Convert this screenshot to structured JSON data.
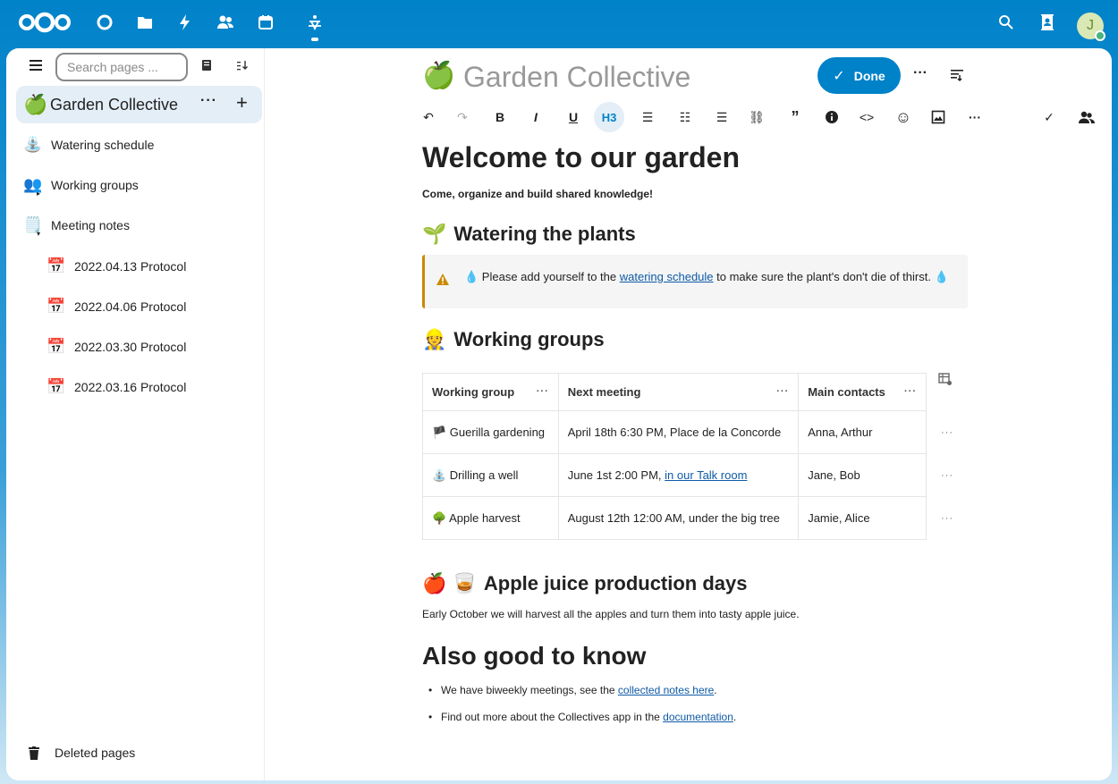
{
  "topbar": {
    "apps": [
      "dashboard-icon",
      "files-icon",
      "activity-icon",
      "contacts-icon",
      "calendar-icon",
      "collectives-icon"
    ],
    "search_icon": "search-icon",
    "contacts_menu_icon": "contacts-menu-icon",
    "avatar_initial": "J"
  },
  "sidebar": {
    "search_placeholder": "Search pages ...",
    "collective": {
      "emoji": "🍏",
      "title": "Garden Collective"
    },
    "pages": [
      {
        "emoji": "⛲",
        "label": "Watering schedule"
      },
      {
        "emoji": "👥",
        "label": "Working groups"
      },
      {
        "emoji": "🗒️",
        "label": "Meeting notes"
      },
      {
        "emoji": "📅",
        "label": "2022.04.13 Protocol"
      },
      {
        "emoji": "📅",
        "label": "2022.04.06 Protocol"
      },
      {
        "emoji": "📅",
        "label": "2022.03.30 Protocol"
      },
      {
        "emoji": "📅",
        "label": "2022.03.16 Protocol"
      }
    ],
    "deleted_label": "Deleted pages"
  },
  "header": {
    "emoji": "🍏",
    "title": "Garden Collective",
    "done_label": "Done"
  },
  "toolbar": {
    "heading_label": "H3"
  },
  "document": {
    "h1": "Welcome to our garden",
    "subtitle": "Come, organize and build shared knowledge!",
    "watering": {
      "emoji": "🌱",
      "heading": "Watering the plants",
      "callout_before": "💧 Please add yourself to the ",
      "callout_link": "watering schedule",
      "callout_after": " to make sure the plant's don't die of thirst. 💧"
    },
    "groups": {
      "emoji": "👷",
      "heading": "Working groups",
      "columns": [
        "Working group",
        "Next meeting",
        "Main contacts"
      ],
      "rows": [
        {
          "group": "🏴 Guerilla gardening",
          "meeting": "April 18th 6:30 PM, Place de la Concorde",
          "meeting_link": "",
          "contacts": "Anna, Arthur"
        },
        {
          "group": "⛲ Drilling a well",
          "meeting": "June 1st 2:00 PM, ",
          "meeting_link": "in our Talk room",
          "contacts": "Jane, Bob"
        },
        {
          "group": "🌳 Apple harvest",
          "meeting": "August 12th 12:00 AM, under the big tree",
          "meeting_link": "",
          "contacts": "Jamie, Alice"
        }
      ]
    },
    "juice": {
      "emoji": "🍎 🥃",
      "heading": "Apple juice production days",
      "text": "Early October we will harvest all the apples and turn them into tasty apple juice."
    },
    "good_to_know": {
      "heading": "Also good to know",
      "item1_before": "We have biweekly meetings, see the ",
      "item1_link": "collected notes here",
      "item1_after": ".",
      "item2_before": "Find out more about the Collectives app in the ",
      "item2_link": "documentation",
      "item2_after": "."
    }
  },
  "colors": {
    "primary": "#0082c9",
    "callout_border": "#c98a00",
    "link": "#0e5aa7"
  }
}
